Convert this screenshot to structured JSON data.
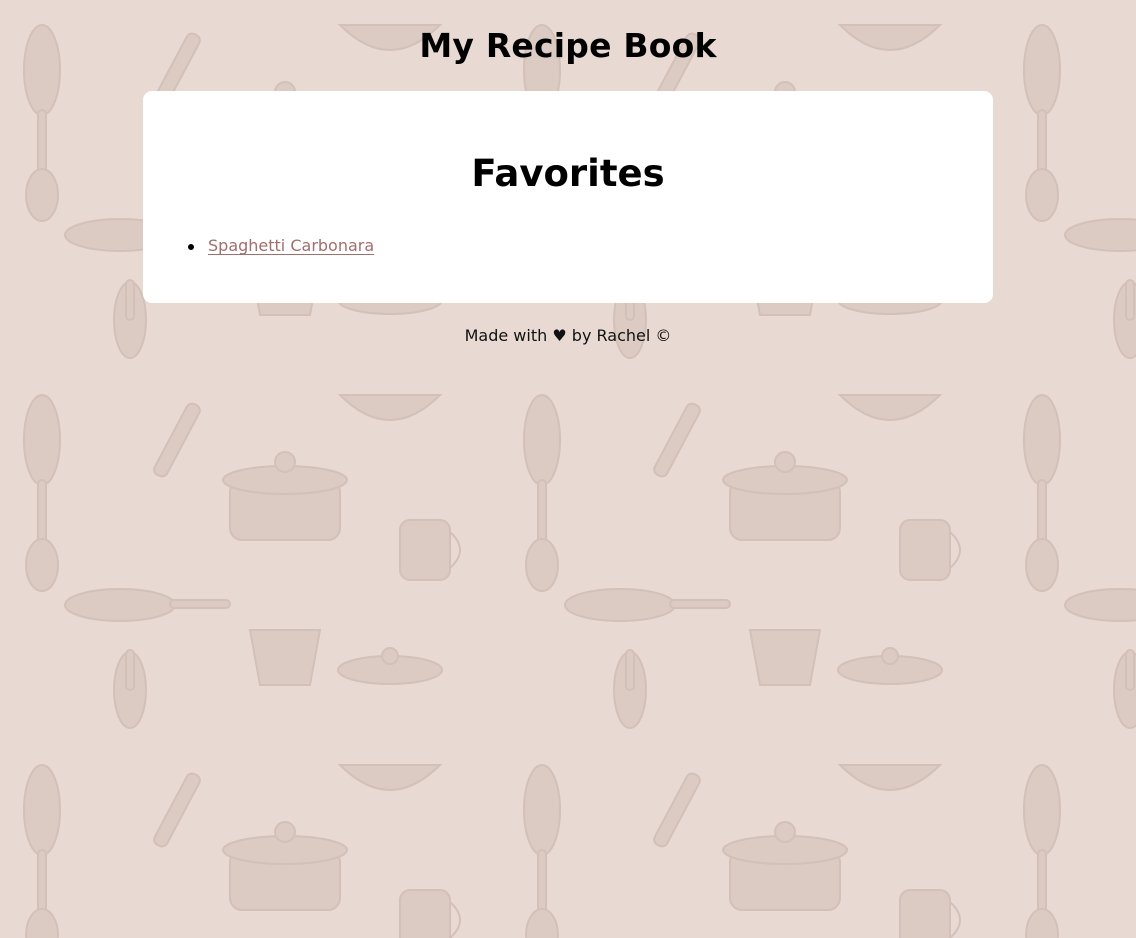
{
  "header": {
    "title": "My Recipe Book"
  },
  "favorites": {
    "heading": "Favorites",
    "items": [
      {
        "label": "Spaghetti Carbonara"
      }
    ]
  },
  "footer": {
    "made_with": "Made with",
    "heart": "♥",
    "by_author": "by Rachel ©"
  },
  "colors": {
    "background": "#e8dad3",
    "pattern": "#d9c8c0",
    "card": "#ffffff",
    "link": "#a06e6b"
  },
  "icons": {
    "background": "kitchen-utensils-pattern",
    "footer": "heart-icon"
  }
}
